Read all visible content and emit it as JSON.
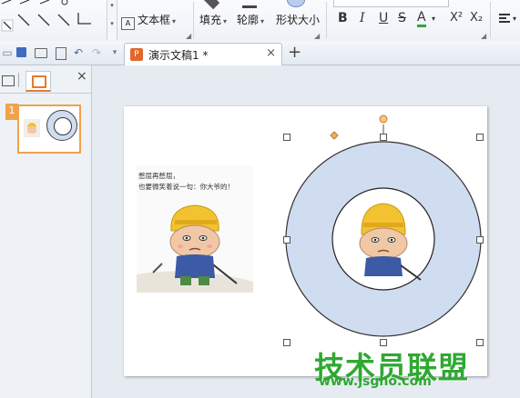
{
  "ribbon": {
    "text_box_label": "文本框",
    "fill_label": "填充",
    "outline_label": "轮廓",
    "shape_size_label": "形状大小",
    "bold": "B",
    "italic": "I",
    "underline": "U",
    "strike": "S",
    "font_color": "A",
    "superscript": "X²",
    "subscript": "X₂"
  },
  "tabbar": {
    "doc_title": "演示文稿1 *",
    "close_symbol": "×",
    "new_tab_symbol": "+"
  },
  "left_panel": {
    "close_symbol": "×",
    "slide_number": "1"
  },
  "slide": {
    "caption_line1": "憋屈再憋屈，",
    "caption_line2": "也要微笑着说一句：你大爷的！"
  },
  "watermark": {
    "text": "技术员联盟",
    "url": "www.jsgho.com"
  },
  "colors": {
    "donut_fill": "#d0ddf0",
    "selection_orange": "#f0a24b",
    "accent_blue": "#2c66c8",
    "watermark_green": "#2fa832"
  },
  "icons": [
    "line-icon",
    "arrow-icon",
    "redo-icon",
    "undo-icon",
    "save-icon",
    "print-icon",
    "open-icon",
    "textbox-icon",
    "fill-icon",
    "outline-icon",
    "shape-size-icon"
  ]
}
